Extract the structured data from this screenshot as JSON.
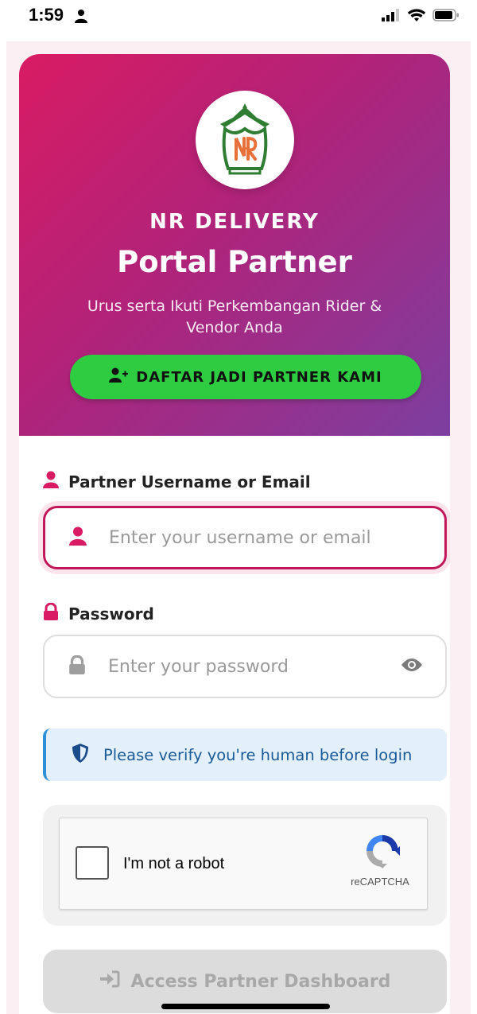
{
  "status_bar": {
    "time": "1:59",
    "icons": [
      "person-icon",
      "signal-icon",
      "wifi-icon",
      "battery-icon"
    ]
  },
  "hero": {
    "brand": "NR DELIVERY",
    "title": "Portal Partner",
    "subtitle": "Urus serta Ikuti Perkembangan Rider & Vendor Anda",
    "register_label": "DAFTAR JADI PARTNER KAMI"
  },
  "form": {
    "username": {
      "label": "Partner Username or Email",
      "placeholder": "Enter your username or email",
      "value": ""
    },
    "password": {
      "label": "Password",
      "placeholder": "Enter your password",
      "value": ""
    },
    "notice": "Please verify you're human before login",
    "captcha": {
      "label": "I'm not a robot",
      "brand": "reCAPTCHA",
      "checked": false
    },
    "submit_label": "Access Partner Dashboard"
  },
  "colors": {
    "brand_pink": "#d81b63",
    "brand_purple": "#7c3fa0",
    "register_green": "#2ecc40",
    "notice_blue": "#1a5a99"
  }
}
